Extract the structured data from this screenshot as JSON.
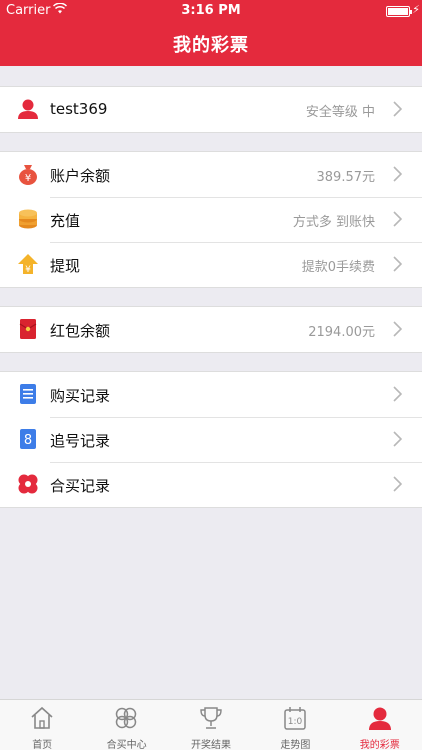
{
  "status": {
    "carrier": "Carrier",
    "time": "3:16 PM"
  },
  "header": {
    "title": "我的彩票"
  },
  "user": {
    "name": "test369",
    "security": "安全等级 中"
  },
  "account": [
    {
      "label": "账户余额",
      "value": "389.57元",
      "icon": "money-bag-icon"
    },
    {
      "label": "充值",
      "value": "方式多 到账快",
      "icon": "coins-icon"
    },
    {
      "label": "提现",
      "value": "提款0手续费",
      "icon": "withdraw-icon"
    }
  ],
  "redpacket": {
    "label": "红包余额",
    "value": "2194.00元",
    "icon": "red-envelope-icon"
  },
  "records": [
    {
      "label": "购买记录",
      "icon": "purchase-record-icon"
    },
    {
      "label": "追号记录",
      "icon": "chase-record-icon"
    },
    {
      "label": "合买记录",
      "icon": "group-buy-record-icon"
    }
  ],
  "tabs": [
    {
      "label": "首页",
      "icon": "home-icon"
    },
    {
      "label": "合买中心",
      "icon": "group-buy-icon"
    },
    {
      "label": "开奖结果",
      "icon": "trophy-icon"
    },
    {
      "label": "走势图",
      "icon": "trend-chart-icon"
    },
    {
      "label": "我的彩票",
      "icon": "user-icon",
      "active": true
    }
  ],
  "colors": {
    "brand": "#e42a3d",
    "background": "#ecebf1",
    "muted": "#9a9a9a"
  }
}
